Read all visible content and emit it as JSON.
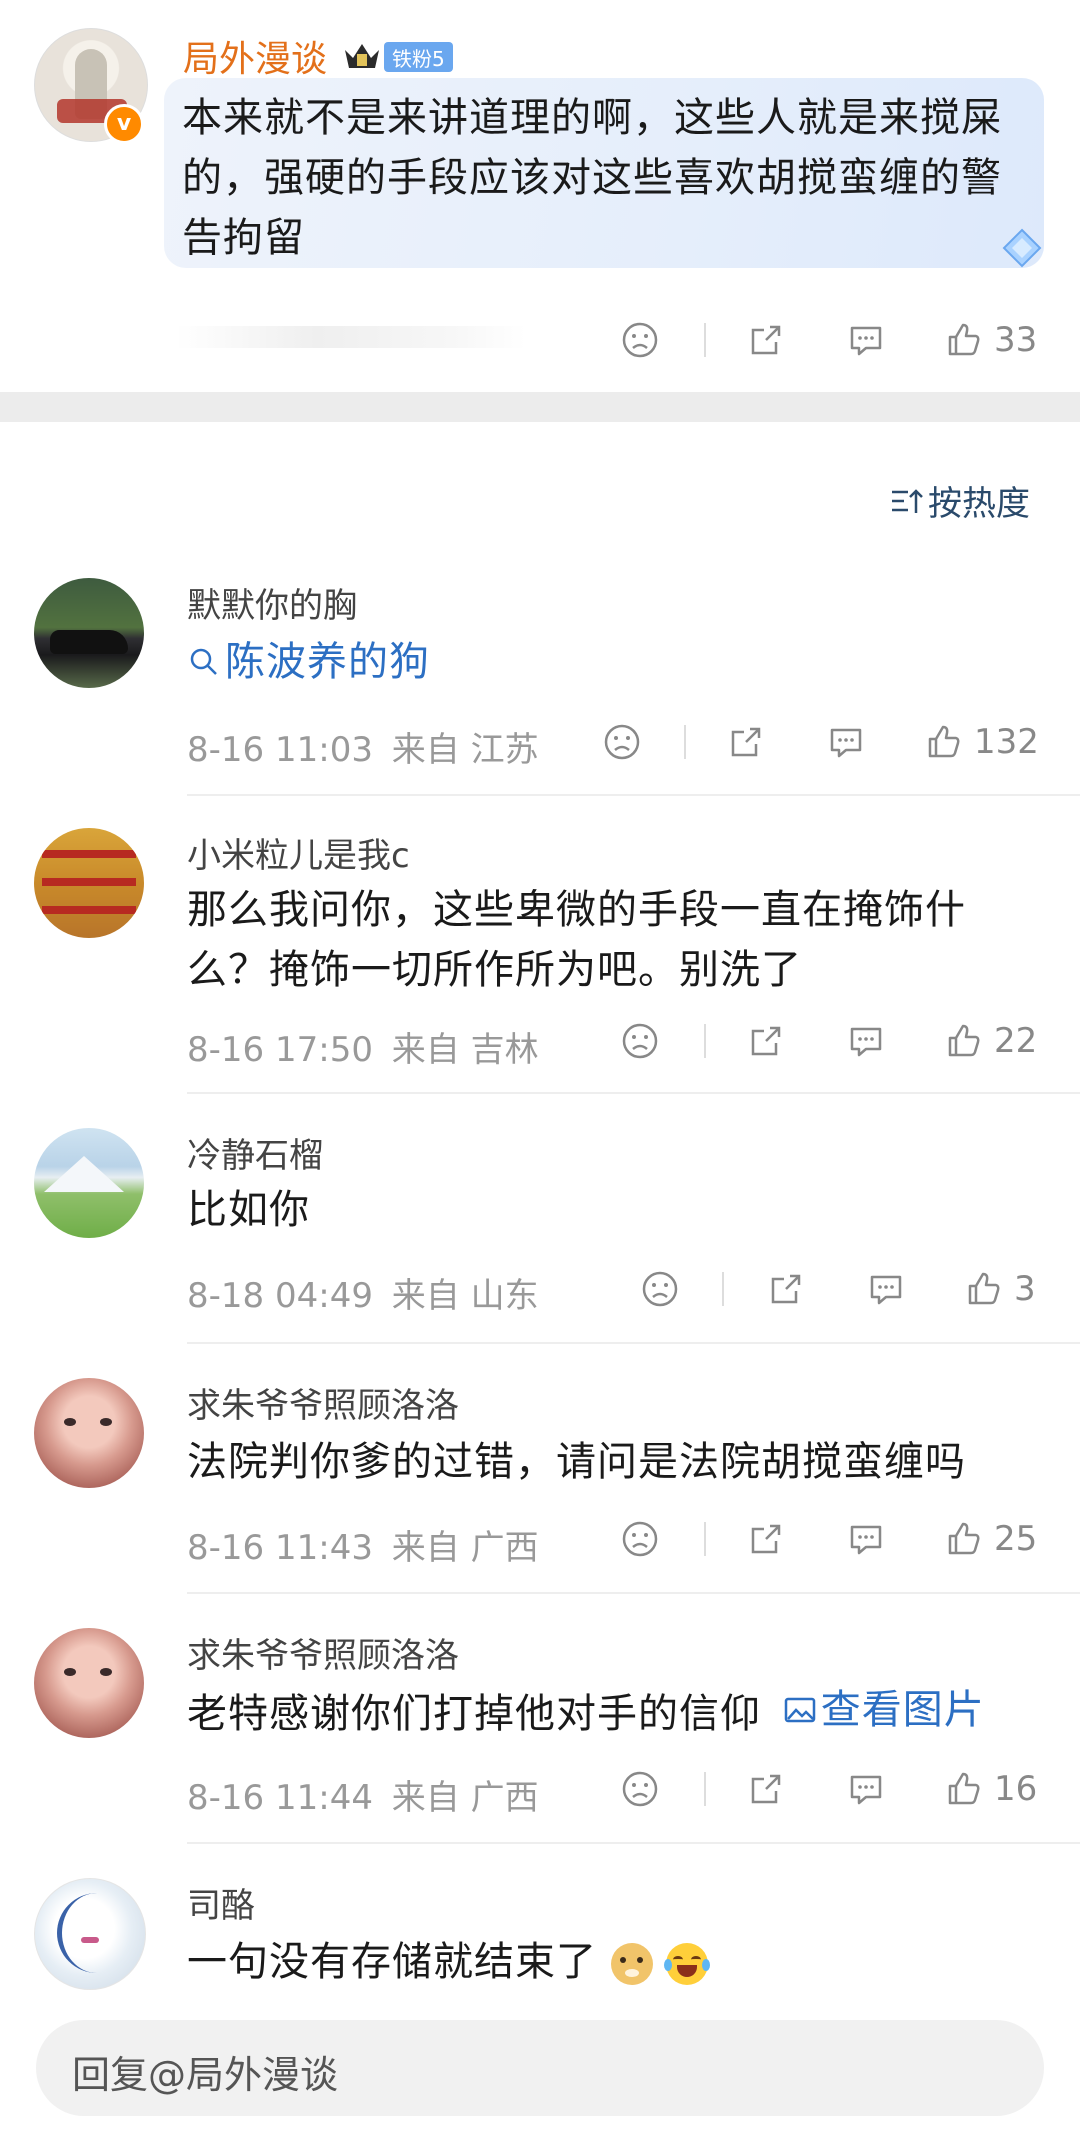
{
  "top_post": {
    "name": "局外漫谈",
    "fan_badge": "铁粉5",
    "verified_glyph": "v",
    "text": "本来就不是来讲道理的啊，这些人就是来搅屎的，强硬的手段应该对这些喜欢胡搅蛮缠的警告拘留",
    "like_count": "33"
  },
  "sort_label": "按热度",
  "comments": [
    {
      "name": "默默你的胸",
      "link_text": "陈波养的狗",
      "date": "8-16 11:03",
      "source": "来自 江苏",
      "likes": "132"
    },
    {
      "name": "小米粒儿是我c",
      "text": "那么我问你，这些卑微的手段一直在掩饰什么？掩饰一切所作所为吧。别洗了",
      "date": "8-16 17:50",
      "source": "来自 吉林",
      "likes": "22"
    },
    {
      "name": "冷静石榴",
      "text": "比如你",
      "date": "8-18 04:49",
      "source": "来自 山东",
      "likes": "3"
    },
    {
      "name": "求朱爷爷照顾洛洛",
      "text": "法院判你爹的过错，请问是法院胡搅蛮缠吗",
      "date": "8-16 11:43",
      "source": "来自 广西",
      "likes": "25"
    },
    {
      "name": "求朱爷爷照顾洛洛",
      "text": "老特感谢你们打掉他对手的信仰",
      "image_link": "查看图片",
      "date": "8-16 11:44",
      "source": "来自 广西",
      "likes": "16"
    },
    {
      "name": "司酪",
      "text": "一句没有存储就结束了"
    }
  ],
  "reply_placeholder": "回复@局外漫谈",
  "colors": {
    "accent_orange": "#e3701a",
    "link_blue": "#2c6fc3",
    "meta_gray": "#999999"
  }
}
